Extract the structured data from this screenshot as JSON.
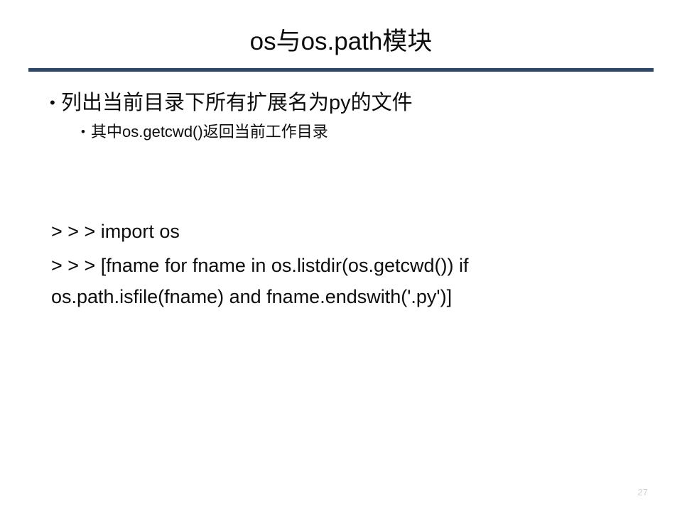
{
  "slide": {
    "title": "os与os.path模块",
    "rule_color": "#2E4663",
    "background_color": "#FFFFFF",
    "text_color": "#0D0D0D",
    "number": "27"
  },
  "bullets": {
    "marker": "•",
    "level1": "列出当前目录下所有扩展名为py的文件",
    "level2": "其中os.getcwd()返回当前工作目录"
  },
  "code": {
    "line1": "> > > import os",
    "line2": "> > > [fname for fname in os.listdir(os.getcwd()) if os.path.isfile(fname) and fname.endswith('.py')]"
  }
}
